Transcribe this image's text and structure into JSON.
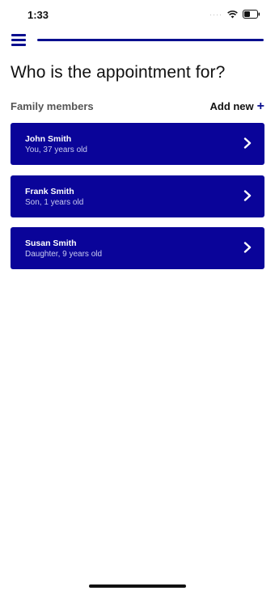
{
  "status_bar": {
    "time": "1:33",
    "signal": "····"
  },
  "header": {
    "progress_fraction": 1.0
  },
  "title": "Who is the appointment for?",
  "section": {
    "label": "Family members",
    "add_new_label": "Add new",
    "add_icon": "+"
  },
  "members": [
    {
      "name": "John Smith",
      "detail": "You, 37 years old"
    },
    {
      "name": "Frank Smith",
      "detail": "Son, 1 years old"
    },
    {
      "name": "Susan Smith",
      "detail": "Daughter, 9 years old"
    }
  ],
  "colors": {
    "accent": "#0a0f8f",
    "card": "#0a0499"
  }
}
